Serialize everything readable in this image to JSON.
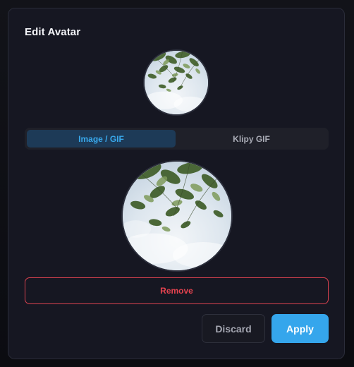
{
  "dialog": {
    "title": "Edit Avatar"
  },
  "preview": {
    "image_description_icon": "avatar-image"
  },
  "tabs": [
    {
      "label": "Image / GIF",
      "active": true
    },
    {
      "label": "Klipy GIF",
      "active": false
    }
  ],
  "actions": {
    "remove_label": "Remove",
    "discard_label": "Discard",
    "apply_label": "Apply"
  },
  "colors": {
    "accent": "#35a6ec",
    "danger": "#e5434f",
    "panel": "#161722"
  }
}
